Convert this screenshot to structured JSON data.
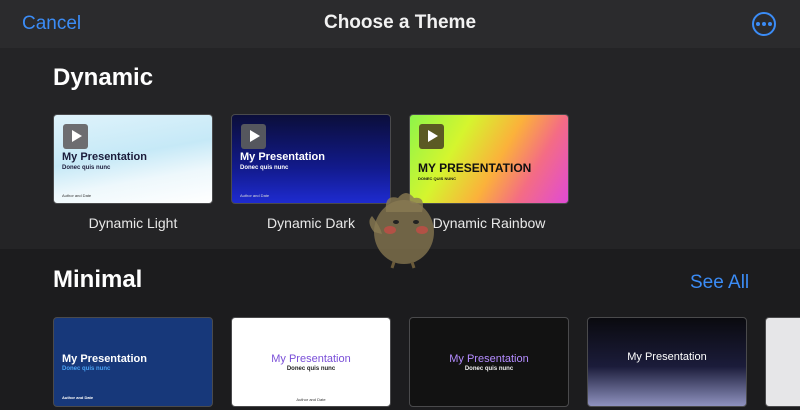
{
  "header": {
    "cancel_label": "Cancel",
    "title": "Choose a Theme",
    "more_icon": "ellipsis-circle-icon"
  },
  "accent_color": "#3b8cf6",
  "sections": [
    {
      "title": "Dynamic",
      "themes": [
        {
          "name": "Dynamic Light",
          "slide_title": "My Presentation",
          "slide_subtitle": "Donec quis nunc",
          "slide_author": "Author and Date"
        },
        {
          "name": "Dynamic Dark",
          "slide_title": "My Presentation",
          "slide_subtitle": "Donec quis nunc",
          "slide_author": "Author and Date"
        },
        {
          "name": "Dynamic Rainbow",
          "slide_title": "MY PRESENTATION",
          "slide_subtitle": "DONEC QUIS NUNC",
          "slide_author": ""
        }
      ]
    },
    {
      "title": "Minimal",
      "see_all_label": "See All",
      "themes": [
        {
          "slide_title": "My Presentation",
          "slide_subtitle": "Donec quis nunc",
          "slide_author": "Author and Date"
        },
        {
          "slide_title": "My Presentation",
          "slide_subtitle": "Donec quis nunc",
          "slide_author": "Author and Date"
        },
        {
          "slide_title": "My Presentation",
          "slide_subtitle": "Donec quis nunc",
          "slide_author": ""
        },
        {
          "slide_title": "My Presentation",
          "slide_subtitle": "",
          "slide_author": ""
        }
      ]
    }
  ]
}
